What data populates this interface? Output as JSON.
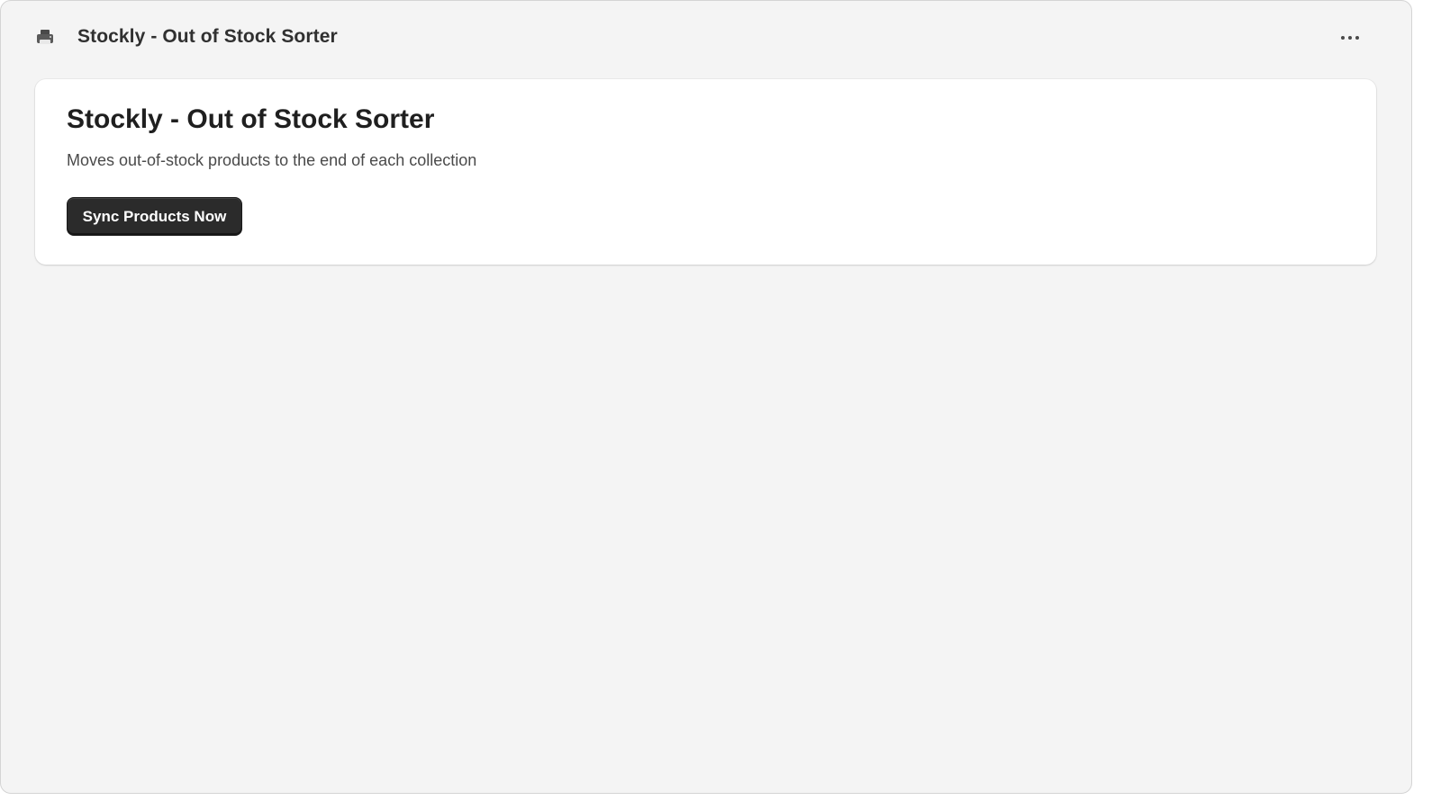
{
  "header": {
    "app_title": "Stockly - Out of Stock Sorter",
    "app_icon": "printer-icon",
    "more_icon": "ellipsis-horizontal-icon"
  },
  "card": {
    "title": "Stockly - Out of Stock Sorter",
    "description": "Moves out-of-stock products to the end of each collection",
    "sync_button_label": "Sync Products Now"
  },
  "colors": {
    "background": "#f4f4f4",
    "card": "#ffffff",
    "primary_button": "#2b2b2b",
    "title_text": "#1f1f1f",
    "body_text": "#4a4a4a"
  }
}
